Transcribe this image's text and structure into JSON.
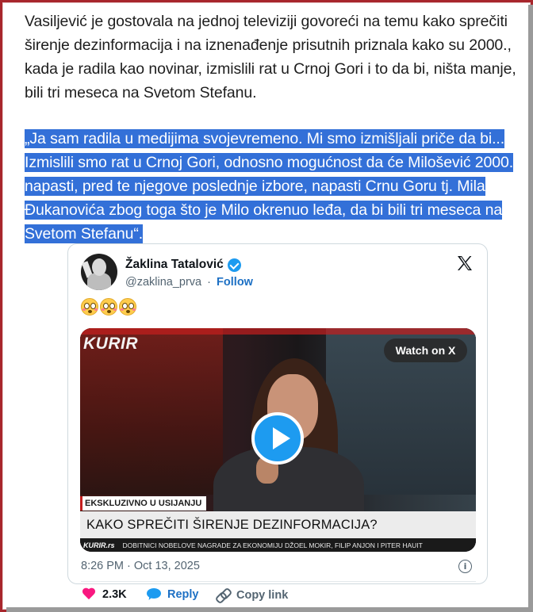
{
  "article": {
    "paragraph": "Vasiljević je gostovala na jednoj televiziji govoreći na temu kako sprečiti širenje dezinformacija i na iznenađenje prisutnih priznala kako su 2000., kada je radila kao novinar, izmislili rat u Crnoj Gori i to da bi, ništa manje, bili tri meseca na Svetom Stefanu.",
    "quote": "„Ja sam radila u medijima svojevremeno. Mi smo izmišljali priče da bi... Izmislili smo rat u Crnoj Gori, odnosno mogućnost da će Milošević 2000. napasti, pred te njegove poslednje izbore, napasti Crnu Goru tj. Mila Đukanovića zbog toga što je Milo okrenuo leđa, da bi bili tri meseca na Svetom Stefanu“."
  },
  "tweet": {
    "display_name": "Žaklina Tatalović",
    "handle": "@zaklina_prva",
    "separator": "·",
    "follow_label": "Follow",
    "emoji_icons": [
      "flushed-face-icon",
      "flushed-face-icon",
      "flushed-face-icon"
    ],
    "video": {
      "channel_logo": "KURIR",
      "watch_label": "Watch on X",
      "lower_third_tag": "EKSKLUZIVNO U USIJANJU",
      "headline": "KAKO SPREČITI ŠIRENJE DEZINFORMACIJA?",
      "ticker_logo": "KURIR.rs",
      "ticker_text": "DOBITNICI NOBELOVE NAGRADE ZA EKONOMIJU DŽOEL MOKIR, FILIP ANJON I PITER HAUIT"
    },
    "timestamp": "8:26 PM · Oct 13, 2025",
    "likes": "2.3K",
    "reply_label": "Reply",
    "copy_link_label": "Copy link",
    "colors": {
      "accent": "#1d9bf0",
      "like": "#f91880",
      "highlight": "#3370d8",
      "frame": "#a8262c"
    }
  }
}
